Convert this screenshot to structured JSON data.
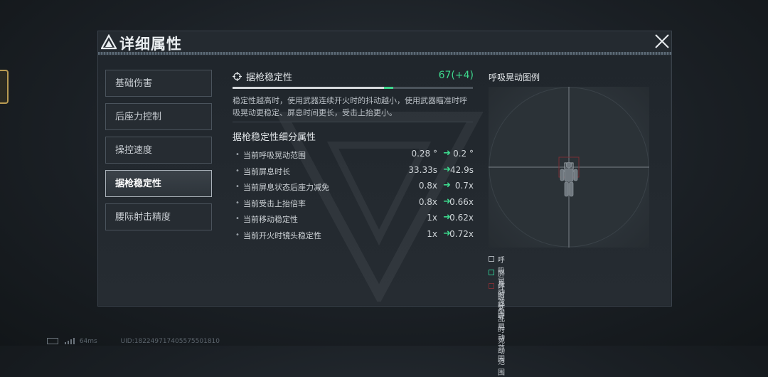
{
  "window": {
    "title": "详细属性",
    "close_icon": "close-icon"
  },
  "tabs": [
    {
      "label": "基础伤害",
      "active": false
    },
    {
      "label": "后座力控制",
      "active": false
    },
    {
      "label": "操控速度",
      "active": false
    },
    {
      "label": "据枪稳定性",
      "active": true
    },
    {
      "label": "腰际射击精度",
      "active": false
    }
  ],
  "stat": {
    "name": "据枪稳定性",
    "value": "67(+4)",
    "base_fraction": 0.63,
    "bonus_fraction": 0.04,
    "description": "稳定性越高时，使用武器连续开火时的抖动越小，使用武器瞄准时呼吸晃动更稳定、屏息时间更长，受击上抬更小。"
  },
  "sub_attributes": {
    "title": "据枪稳定性细分属性",
    "items": [
      {
        "label": "当前呼吸晃动范围",
        "current": "0.28 °",
        "new": "0.2 °"
      },
      {
        "label": "当前屏息时长",
        "current": "33.33s",
        "new": "42.9s"
      },
      {
        "label": "当前屏息状态后座力减免",
        "current": "0.8x",
        "new": "0.7x"
      },
      {
        "label": "当前受击上抬倍率",
        "current": "0.8x",
        "new": "0.66x"
      },
      {
        "label": "当前移动稳定性",
        "current": "1x",
        "new": "0.62x"
      },
      {
        "label": "当前开火时镜头稳定性",
        "current": "1x",
        "new": "0.72x"
      }
    ]
  },
  "diagram": {
    "title": "呼吸晃动图例",
    "legend": [
      {
        "label": "呼吸晃动范围",
        "color": "#a7adb3"
      },
      {
        "label": "屏息时呼吸晃动范围",
        "color": "#2fb889"
      },
      {
        "label": "呼吸紊乱时晃动范围",
        "color": "#7a2f35"
      }
    ]
  },
  "footer": {
    "ping": "64ms",
    "uid": "UID:182249717405575501810"
  },
  "colors": {
    "accent_green": "#3dd68c",
    "panel_bg": "#242a30"
  }
}
